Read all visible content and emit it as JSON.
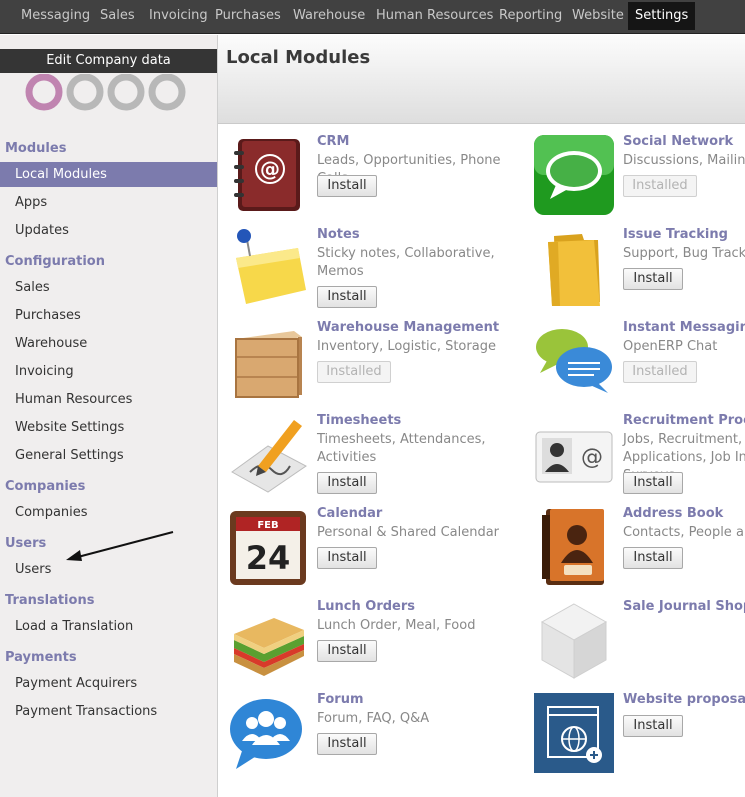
{
  "topnav": [
    {
      "label": "Messaging",
      "active": false
    },
    {
      "label": "Sales",
      "active": false
    },
    {
      "label": "Invoicing",
      "active": false
    },
    {
      "label": "Purchases",
      "active": false
    },
    {
      "label": "Warehouse",
      "active": false
    },
    {
      "label": "Human Resources",
      "active": false
    },
    {
      "label": "Reporting",
      "active": false
    },
    {
      "label": "Website",
      "active": false
    },
    {
      "label": "Settings",
      "active": true
    }
  ],
  "sidebar": {
    "edit_company_label": "Edit Company data",
    "logo_text": "odoo",
    "sections": [
      {
        "title": "Modules",
        "items": [
          {
            "label": "Local Modules",
            "selected": true
          },
          {
            "label": "Apps"
          },
          {
            "label": "Updates"
          }
        ]
      },
      {
        "title": "Configuration",
        "items": [
          {
            "label": "Sales"
          },
          {
            "label": "Purchases"
          },
          {
            "label": "Warehouse"
          },
          {
            "label": "Invoicing"
          },
          {
            "label": "Human Resources"
          },
          {
            "label": "Website Settings"
          },
          {
            "label": "General Settings"
          }
        ]
      },
      {
        "title": "Companies",
        "items": [
          {
            "label": "Companies"
          }
        ]
      },
      {
        "title": "Users",
        "items": [
          {
            "label": "Users"
          }
        ]
      },
      {
        "title": "Translations",
        "items": [
          {
            "label": "Load a Translation"
          }
        ]
      },
      {
        "title": "Payments",
        "items": [
          {
            "label": "Payment Acquirers"
          },
          {
            "label": "Payment Transactions"
          }
        ]
      }
    ]
  },
  "main": {
    "title": "Local Modules",
    "modules": [
      {
        "name": "CRM",
        "desc": "Leads, Opportunities, Phone Calls",
        "button": "Install",
        "installed": false,
        "icon": "address-book-icon"
      },
      {
        "name": "Social Network",
        "desc": "Discussions, Mailing Lists, News",
        "button": "Installed",
        "installed": true,
        "icon": "chat-bubble-icon"
      },
      {
        "name": "Notes",
        "desc": "Sticky notes, Collaborative, Memos",
        "button": "Install",
        "installed": false,
        "icon": "sticky-note-icon"
      },
      {
        "name": "Issue Tracking",
        "desc": "Support, Bug Tracker, Helpdesk",
        "button": "Install",
        "installed": false,
        "icon": "folder-icon"
      },
      {
        "name": "Warehouse Management",
        "desc": "Inventory, Logistic, Storage",
        "button": "Installed",
        "installed": true,
        "icon": "crate-icon"
      },
      {
        "name": "Instant Messaging",
        "desc": "OpenERP Chat",
        "button": "Installed",
        "installed": true,
        "icon": "speech-bubbles-icon"
      },
      {
        "name": "Timesheets",
        "desc": "Timesheets, Attendances, Activities",
        "button": "Install",
        "installed": false,
        "icon": "pencil-paper-icon"
      },
      {
        "name": "Recruitment Process",
        "desc": "Jobs, Recruitment, Applications, Job Interviews, Surveys",
        "button": "Install",
        "installed": false,
        "icon": "contact-card-icon"
      },
      {
        "name": "Calendar",
        "desc": "Personal & Shared Calendar",
        "button": "Install",
        "installed": false,
        "icon": "calendar-icon",
        "cal_month": "FEB",
        "cal_day": "24"
      },
      {
        "name": "Address Book",
        "desc": "Contacts, People and Companies",
        "button": "Install",
        "installed": false,
        "icon": "address-book-person-icon"
      },
      {
        "name": "Lunch Orders",
        "desc": "Lunch Order, Meal, Food",
        "button": "Install",
        "installed": false,
        "icon": "sandwich-icon"
      },
      {
        "name": "Sale Journal Shop",
        "desc": "",
        "button": "",
        "installed": false,
        "icon": "cube-icon"
      },
      {
        "name": "Forum",
        "desc": "Forum, FAQ, Q&A",
        "button": "Install",
        "installed": false,
        "icon": "users-bubble-icon"
      },
      {
        "name": "Website proposal for the Sale Orders",
        "desc": "",
        "button": "Install",
        "installed": false,
        "icon": "website-globe-icon"
      }
    ]
  },
  "colors": {
    "accent": "#7c7bad",
    "topbar": "#414141",
    "sidebar": "#f0eeee"
  }
}
